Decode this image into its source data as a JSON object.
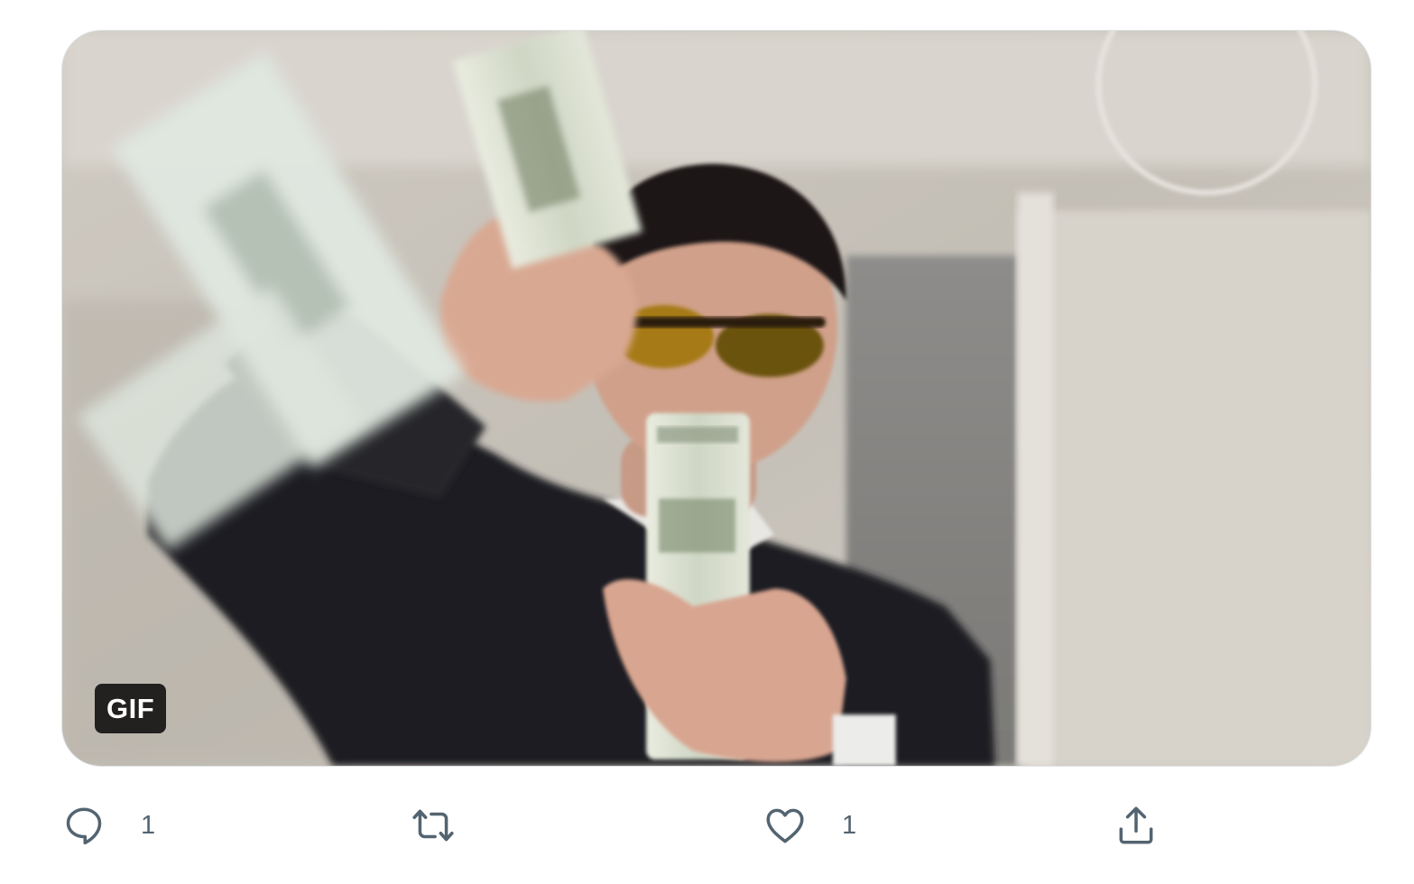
{
  "tweet": {
    "media": {
      "type": "gif",
      "badge_label": "GIF",
      "description_icon": "gif-media"
    },
    "actions": {
      "reply": {
        "icon": "reply-icon",
        "count": "1"
      },
      "retweet": {
        "icon": "retweet-icon",
        "count": ""
      },
      "like": {
        "icon": "heart-icon",
        "count": "1"
      },
      "share": {
        "icon": "share-icon",
        "count": ""
      }
    },
    "colors": {
      "action_gray": "#536471",
      "badge_bg": "#000000",
      "background": "#ffffff"
    }
  }
}
